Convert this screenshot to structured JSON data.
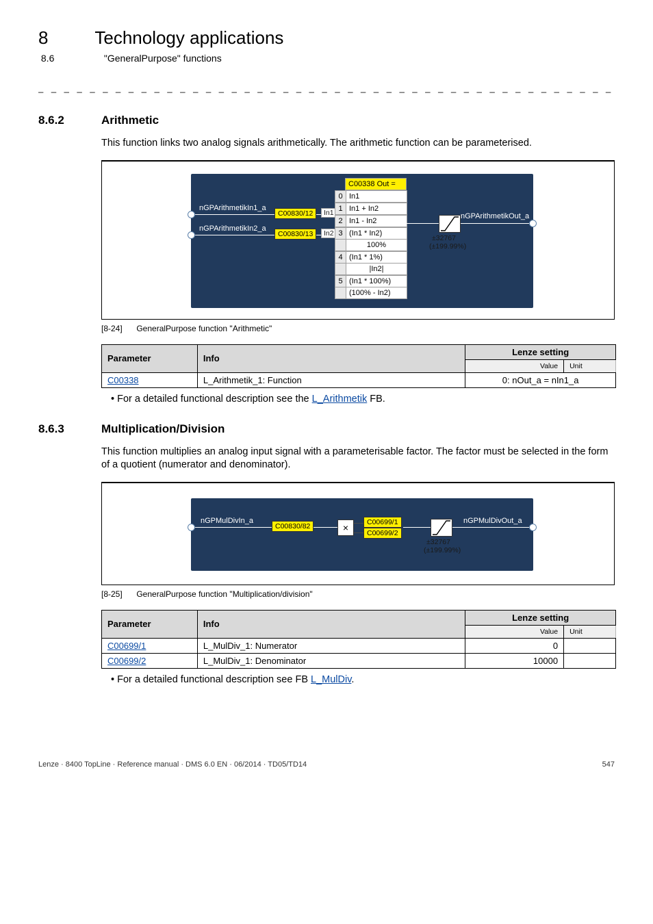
{
  "header": {
    "chapter_num": "8",
    "chapter_title": "Technology applications",
    "section_num": "8.6",
    "section_title": "\"GeneralPurpose\" functions"
  },
  "dashes": "_ _ _ _ _ _ _ _ _ _ _ _ _ _ _ _ _ _ _ _ _ _ _ _ _ _ _ _ _ _ _ _ _ _ _ _ _ _ _ _ _ _ _ _ _ _ _ _ _ _ _ _ _ _ _ _ _ _ _ _ _ _ _ _",
  "s862": {
    "num": "8.6.2",
    "title": "Arithmetic",
    "intro": "This function links two analog signals arithmetically. The arithmetic function can be parameterised.",
    "fig": {
      "in1_label": "nGPArithmetikIn1_a",
      "in1_tag": "C00830/12",
      "in1_pin": "In1",
      "in2_label": "nGPArithmetikIn2_a",
      "in2_tag": "C00830/13",
      "in2_pin": "In2",
      "out_label": "nGPArithmetikOut_a",
      "head_tag": "C00338",
      "head_txt": "Out =",
      "opts": [
        {
          "i": "0",
          "t": "In1"
        },
        {
          "i": "1",
          "t": "In1 + In2"
        },
        {
          "i": "2",
          "t": "In1 - In2"
        },
        {
          "i": "3",
          "t": "(In1 * In2)"
        },
        {
          "i": "",
          "t": "100%"
        },
        {
          "i": "4",
          "t": "(In1 * 1%)"
        },
        {
          "i": "",
          "t": "|In2|"
        },
        {
          "i": "5",
          "t": "(In1 * 100%)"
        },
        {
          "i": "",
          "t": "(100% - In2)"
        }
      ],
      "sat1": "±32767",
      "sat2": "(±199.99%)"
    },
    "caption_num": "[8-24]",
    "caption_txt": "GeneralPurpose function \"Arithmetic\"",
    "table": {
      "h_param": "Parameter",
      "h_info": "Info",
      "h_lenze": "Lenze setting",
      "h_value": "Value",
      "h_unit": "Unit",
      "r1_param": "C00338",
      "r1_info": "L_Arithmetik_1: Function",
      "r1_val": "0: nOut_a = nIn1_a"
    },
    "bullet_pre": "For a detailed functional description see the ",
    "bullet_link": "L_Arithmetik",
    "bullet_post": " FB."
  },
  "s863": {
    "num": "8.6.3",
    "title": "Multiplication/Division",
    "intro": "This function multiplies an analog input signal with a parameterisable factor. The factor must be selected in the form of a quotient (numerator and denominator).",
    "fig": {
      "in_label": "nGPMulDivIn_a",
      "in_tag": "C00830/82",
      "num_tag": "C00699/1",
      "den_tag": "C00699/2",
      "out_label": "nGPMulDivOut_a",
      "sat1": "±32767",
      "sat2": "(±199.99%)"
    },
    "caption_num": "[8-25]",
    "caption_txt": "GeneralPurpose function \"Multiplication/division\"",
    "table": {
      "h_param": "Parameter",
      "h_info": "Info",
      "h_lenze": "Lenze setting",
      "h_value": "Value",
      "h_unit": "Unit",
      "r1_param": "C00699/1",
      "r1_info": "L_MulDiv_1: Numerator",
      "r1_val": "0",
      "r2_param": "C00699/2",
      "r2_info": "L_MulDiv_1: Denominator",
      "r2_val": "10000"
    },
    "bullet_pre": "For a detailed functional description see FB ",
    "bullet_link": "L_MulDiv",
    "bullet_post": "."
  },
  "footer": {
    "left": "Lenze · 8400 TopLine · Reference manual · DMS 6.0 EN · 06/2014 · TD05/TD14",
    "right": "547"
  }
}
